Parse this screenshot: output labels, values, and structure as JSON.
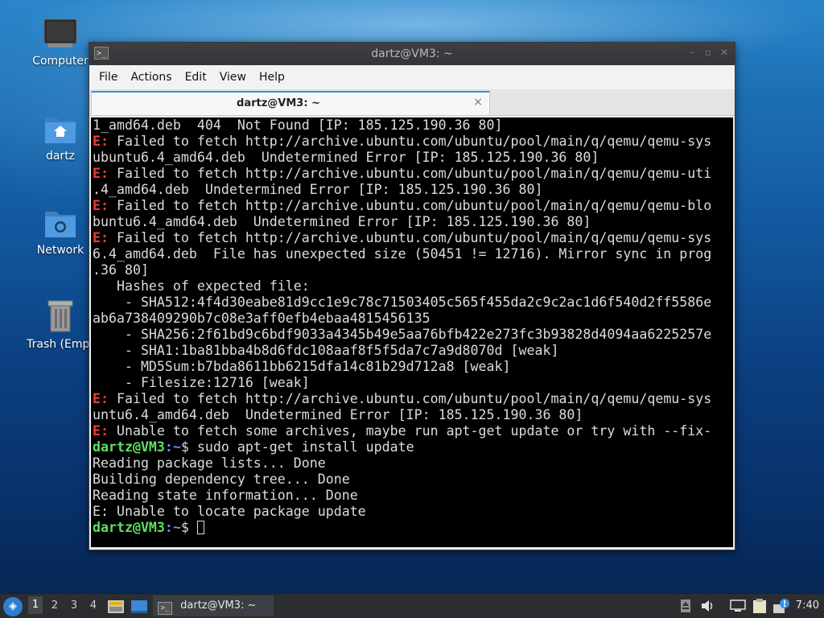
{
  "desktop": {
    "icons": [
      {
        "label": "Computer",
        "icon": "computer-icon"
      },
      {
        "label": "dartz",
        "icon": "home-folder-icon"
      },
      {
        "label": "Network",
        "icon": "network-folder-icon"
      },
      {
        "label": "Trash (Empt",
        "icon": "trash-icon"
      }
    ]
  },
  "window": {
    "title": "dartz@VM3: ~",
    "menu": [
      "File",
      "Actions",
      "Edit",
      "View",
      "Help"
    ],
    "tab": {
      "label": "dartz@VM3: ~",
      "close": "×"
    }
  },
  "terminal": {
    "lines": [
      {
        "text": "1_amd64.deb  404  Not Found [IP: 185.125.190.36 80]"
      },
      {
        "prefix": "E:",
        "text": " Failed to fetch http://archive.ubuntu.com/ubuntu/pool/main/q/qemu/qemu-sys"
      },
      {
        "text": "ubuntu6.4_amd64.deb  Undetermined Error [IP: 185.125.190.36 80]"
      },
      {
        "prefix": "E:",
        "text": " Failed to fetch http://archive.ubuntu.com/ubuntu/pool/main/q/qemu/qemu-uti"
      },
      {
        "text": ".4_amd64.deb  Undetermined Error [IP: 185.125.190.36 80]"
      },
      {
        "prefix": "E:",
        "text": " Failed to fetch http://archive.ubuntu.com/ubuntu/pool/main/q/qemu/qemu-blo"
      },
      {
        "text": "buntu6.4_amd64.deb  Undetermined Error [IP: 185.125.190.36 80]"
      },
      {
        "prefix": "E:",
        "text": " Failed to fetch http://archive.ubuntu.com/ubuntu/pool/main/q/qemu/qemu-sys"
      },
      {
        "text": "6.4_amd64.deb  File has unexpected size (50451 != 12716). Mirror sync in prog"
      },
      {
        "text": ".36 80]"
      },
      {
        "text": "   Hashes of expected file:"
      },
      {
        "text": "    - SHA512:4f4d30eabe81d9cc1e9c78c71503405c565f455da2c9c2ac1d6f540d2ff5586e"
      },
      {
        "text": "ab6a738409290b7c08e3aff0efb4ebaa4815456135"
      },
      {
        "text": "    - SHA256:2f61bd9c6bdf9033a4345b49e5aa76bfb422e273fc3b93828d4094aa6225257e"
      },
      {
        "text": "    - SHA1:1ba81bba4b8d6fdc108aaf8f5f5da7c7a9d8070d [weak]"
      },
      {
        "text": "    - MD5Sum:b7bda8611bb6215dfa14c81b29d712a8 [weak]"
      },
      {
        "text": "    - Filesize:12716 [weak]"
      },
      {
        "prefix": "E:",
        "text": " Failed to fetch http://archive.ubuntu.com/ubuntu/pool/main/q/qemu/qemu-sys"
      },
      {
        "text": "untu6.4_amd64.deb  Undetermined Error [IP: 185.125.190.36 80]"
      },
      {
        "prefix": "E:",
        "text": " Unable to fetch some archives, maybe run apt-get update or try with --fix-"
      },
      {
        "user": "dartz@VM3",
        "path": ":~",
        "text": "$ sudo apt-get install update"
      },
      {
        "text": "Reading package lists... Done"
      },
      {
        "text": "Building dependency tree... Done"
      },
      {
        "text": "Reading state information... Done"
      },
      {
        "text": "E: Unable to locate package update"
      },
      {
        "user": "dartz@VM3",
        "path": ":~",
        "text": "$ ",
        "cursor": true
      }
    ]
  },
  "taskbar": {
    "start_icon": "lubuntu-start-icon",
    "workspaces": [
      "1",
      "2",
      "3",
      "4"
    ],
    "active_workspace": "1",
    "task_label": "dartz@VM3: ~",
    "clock": "7:40"
  }
}
